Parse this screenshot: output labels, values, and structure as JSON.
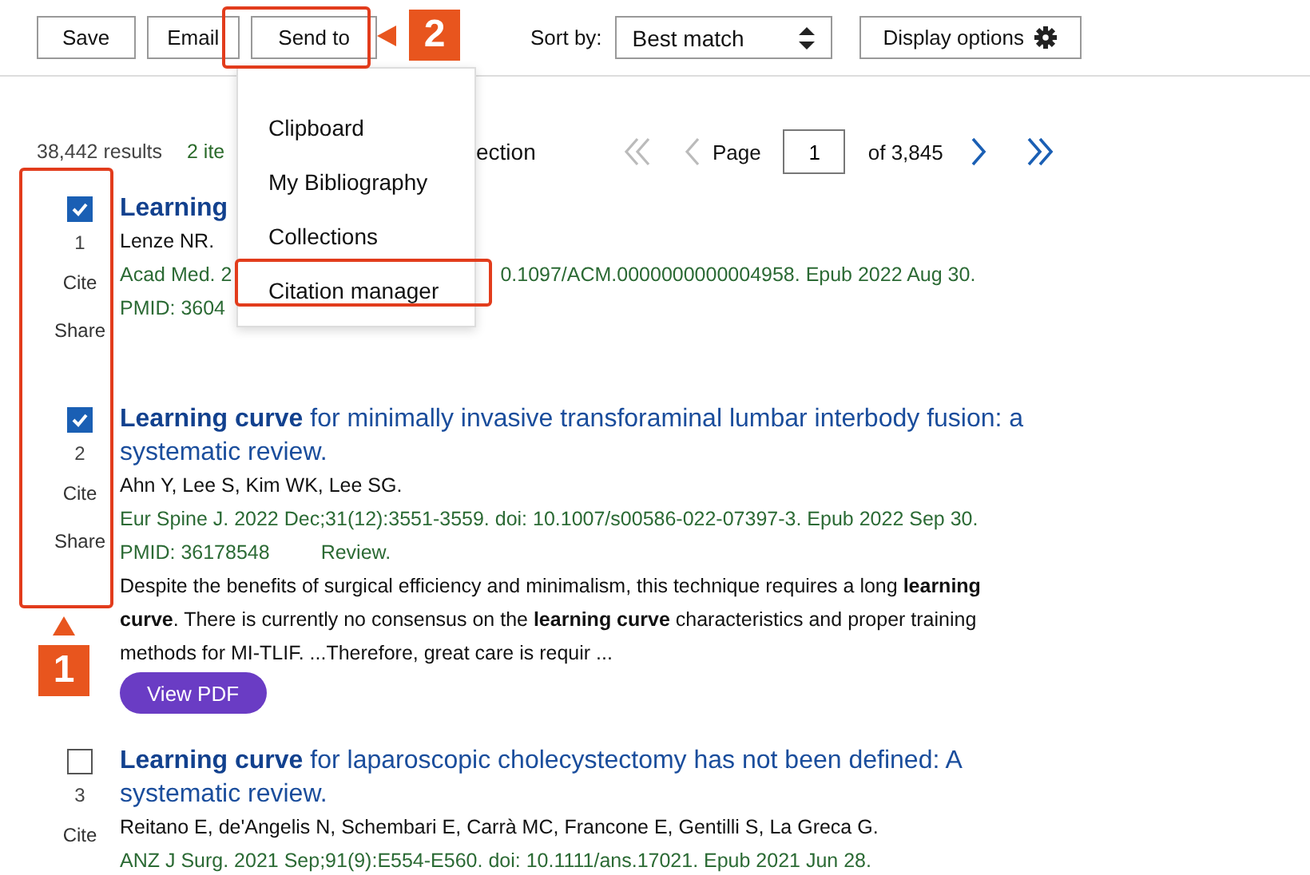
{
  "toolbar": {
    "buttons": [
      "Save",
      "Email",
      "Send to"
    ],
    "sort_label": "Sort by:",
    "sort_value": "Best match",
    "display_options": "Display options"
  },
  "send_to_menu": {
    "items": [
      {
        "label": "Clipboard",
        "highlighted": false
      },
      {
        "label": "My Bibliography",
        "highlighted": false
      },
      {
        "label": "Collections",
        "highlighted": false
      },
      {
        "label": "Citation manager",
        "highlighted": true
      }
    ]
  },
  "results": {
    "count": "38,442 results",
    "selection": [
      "2 ite",
      "ection"
    ]
  },
  "pagination": {
    "page_label": "Page",
    "page_value": "1",
    "total": "of 3,845"
  },
  "articles": [
    {
      "checked": true,
      "number": "1",
      "actions": [
        "Cite",
        "Share"
      ],
      "title_bold": "Learning",
      "authors": "Lenze NR.",
      "citation": [
        "Acad Med. 2",
        "0.1097/ACM.0000000000004958. Epub 2022 Aug 30."
      ],
      "pmid": "PMID: 3604"
    },
    {
      "checked": true,
      "number": "2",
      "actions": [
        "Cite",
        "Share"
      ],
      "title_bold": "Learning curve",
      "title_rest": " for minimally invasive transforaminal lumbar interbody fusion: a systematic review.",
      "authors": "Ahn Y, Lee S, Kim WK, Lee SG.",
      "citation": [
        "Eur Spine J. 2022 Dec;31(12):3551-3559. doi: 10.1007/s00586-022-07397-3. Epub 2022 Sep 30."
      ],
      "pmid": "PMID: 36178548",
      "type": "Review.",
      "snippet": "Despite the benefits of surgical efficiency and minimalism, this technique requires a long **learning curve**. There is currently no consensus on the **learning curve** characteristics and proper training methods for MI-TLIF. ...Therefore, great care is requir ...",
      "pdf": "View PDF"
    },
    {
      "checked": false,
      "number": "3",
      "actions": [
        "Cite"
      ],
      "title_bold": "Learning curve",
      "title_rest": " for laparoscopic cholecystectomy has not been defined: A systematic review.",
      "authors": "Reitano E, de'Angelis N, Schembari E, Carrà MC, Francone E, Gentilli S, La Greca G.",
      "citation": [
        "ANZ J Surg. 2021 Sep;91(9):E554-E560. doi: 10.1111/ans.17021. Epub 2021 Jun 28."
      ]
    }
  ],
  "annotations": [
    {
      "label": "2"
    },
    {
      "label": "1"
    }
  ]
}
